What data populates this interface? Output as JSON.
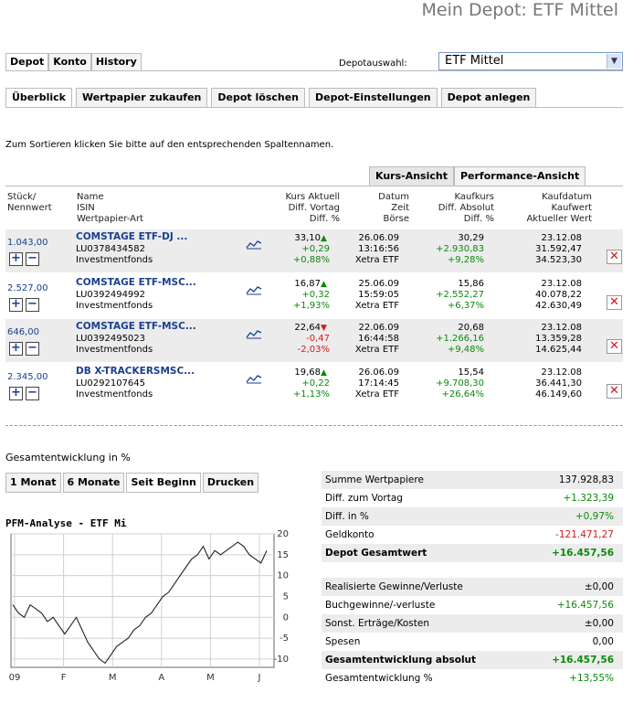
{
  "page_title": "Mein Depot: ETF Mittel",
  "top_tabs": [
    "Depot",
    "Konto",
    "History"
  ],
  "depot_select": {
    "label": "Depotauswahl:",
    "value": "ETF Mittel"
  },
  "sub_tabs": [
    "Überblick",
    "Wertpapier zukaufen",
    "Depot löschen",
    "Depot-Einstellungen",
    "Depot anlegen"
  ],
  "hint": "Zum Sortieren klicken Sie bitte auf den entsprechenden Spaltennamen.",
  "view_tabs": [
    "Kurs-Ansicht",
    "Performance-Ansicht"
  ],
  "columns": {
    "c1": [
      "Stück/",
      "Nennwert"
    ],
    "c2": [
      "Name",
      "ISIN",
      "Wertpapier-Art"
    ],
    "c3": [
      "Kurs Aktuell",
      "Diff. Vortag",
      "Diff. %"
    ],
    "c4": [
      "Datum",
      "Zeit",
      "Börse"
    ],
    "c5": [
      "Kaufkurs",
      "Diff. Absolut",
      "Diff. %"
    ],
    "c6": [
      "Kaufdatum",
      "Kaufwert",
      "Aktueller Wert"
    ]
  },
  "positions": [
    {
      "qty": "1.043,00",
      "name": "COMSTAGE ETF-DJ ...",
      "isin": "LU0378434582",
      "type": "Investmentfonds",
      "kurs": "33,10",
      "diff_vortag": "+0,29",
      "diff_pct": "+0,88%",
      "trend": "up",
      "datum": "26.06.09",
      "zeit": "13:16:56",
      "boerse": "Xetra ETF",
      "kaufkurs": "30,29",
      "diff_abs": "+2.930,83",
      "diff_pct2": "+9,28%",
      "kaufdatum": "23.12.08",
      "kaufwert": "31.592,47",
      "akt_wert": "34.523,30"
    },
    {
      "qty": "2.527,00",
      "name": "COMSTAGE ETF-MSC...",
      "isin": "LU0392494992",
      "type": "Investmentfonds",
      "kurs": "16,87",
      "diff_vortag": "+0,32",
      "diff_pct": "+1,93%",
      "trend": "up",
      "datum": "25.06.09",
      "zeit": "15:59:05",
      "boerse": "Xetra ETF",
      "kaufkurs": "15,86",
      "diff_abs": "+2.552,27",
      "diff_pct2": "+6,37%",
      "kaufdatum": "23.12.08",
      "kaufwert": "40.078,22",
      "akt_wert": "42.630,49"
    },
    {
      "qty": "646,00",
      "name": "COMSTAGE ETF-MSC...",
      "isin": "LU0392495023",
      "type": "Investmentfonds",
      "kurs": "22,64",
      "diff_vortag": "-0,47",
      "diff_pct": "-2,03%",
      "trend": "down",
      "datum": "22.06.09",
      "zeit": "16:44:58",
      "boerse": "Xetra ETF",
      "kaufkurs": "20,68",
      "diff_abs": "+1.266,16",
      "diff_pct2": "+9,48%",
      "kaufdatum": "23.12.08",
      "kaufwert": "13.359,28",
      "akt_wert": "14.625,44"
    },
    {
      "qty": "2.345,00",
      "name": "DB X-TRACKERSMSC...",
      "isin": "LU0292107645",
      "type": "Investmentfonds",
      "kurs": "19,68",
      "diff_vortag": "+0,22",
      "diff_pct": "+1,13%",
      "trend": "up",
      "datum": "26.06.09",
      "zeit": "17:14:45",
      "boerse": "Xetra ETF",
      "kaufkurs": "15,54",
      "diff_abs": "+9.708,30",
      "diff_pct2": "+26,64%",
      "kaufdatum": "23.12.08",
      "kaufwert": "36.441,30",
      "akt_wert": "46.149,60"
    }
  ],
  "perf_title": "Gesamtentwicklung in %",
  "period_tabs": [
    "1 Monat",
    "6 Monate",
    "Seit Beginn",
    "Drucken"
  ],
  "chart_title": "PFM-Analyse - ETF Mi",
  "chart_data": {
    "type": "line",
    "x": [
      "09",
      "F",
      "M",
      "A",
      "M",
      "J"
    ],
    "ylim": [
      -12,
      20
    ],
    "y_ticks": [
      "20",
      "15",
      "10",
      "5",
      "0",
      "-5",
      "-10"
    ],
    "y": [
      3,
      1,
      0,
      3,
      2,
      1,
      -1,
      0,
      -2,
      -4,
      -2,
      0,
      -3,
      -6,
      -8,
      -10,
      -11,
      -9,
      -7,
      -6,
      -5,
      -3,
      -2,
      0,
      1,
      3,
      5,
      6,
      8,
      10,
      12,
      14,
      15,
      17,
      14,
      16,
      15,
      16,
      17,
      18,
      17,
      15,
      14,
      13,
      16
    ]
  },
  "summary_a": [
    {
      "label": "Summe Wertpapiere",
      "value": "137.928,83",
      "tone": "normal"
    },
    {
      "label": "Diff. zum Vortag",
      "value": "+1.323,39",
      "tone": "pos"
    },
    {
      "label": "Diff. in %",
      "value": "+0,97%",
      "tone": "pos"
    },
    {
      "label": "Geldkonto",
      "value": "-121.471,27",
      "tone": "neg"
    },
    {
      "label": "Depot Gesamtwert",
      "value": "+16.457,56",
      "tone": "pos-bold"
    }
  ],
  "summary_b": [
    {
      "label": "Realisierte Gewinne/Verluste",
      "value": "±0,00",
      "tone": "normal"
    },
    {
      "label": "Buchgewinne/-verluste",
      "value": "+16.457,56",
      "tone": "pos"
    },
    {
      "label": "Sonst. Erträge/Kosten",
      "value": "±0,00",
      "tone": "normal"
    },
    {
      "label": "Spesen",
      "value": "0,00",
      "tone": "normal"
    },
    {
      "label": "Gesamtentwicklung absolut",
      "value": "+16.457,56",
      "tone": "pos-bold"
    },
    {
      "label": "Gesamtentwicklung %",
      "value": "+13,55%",
      "tone": "pos"
    }
  ]
}
